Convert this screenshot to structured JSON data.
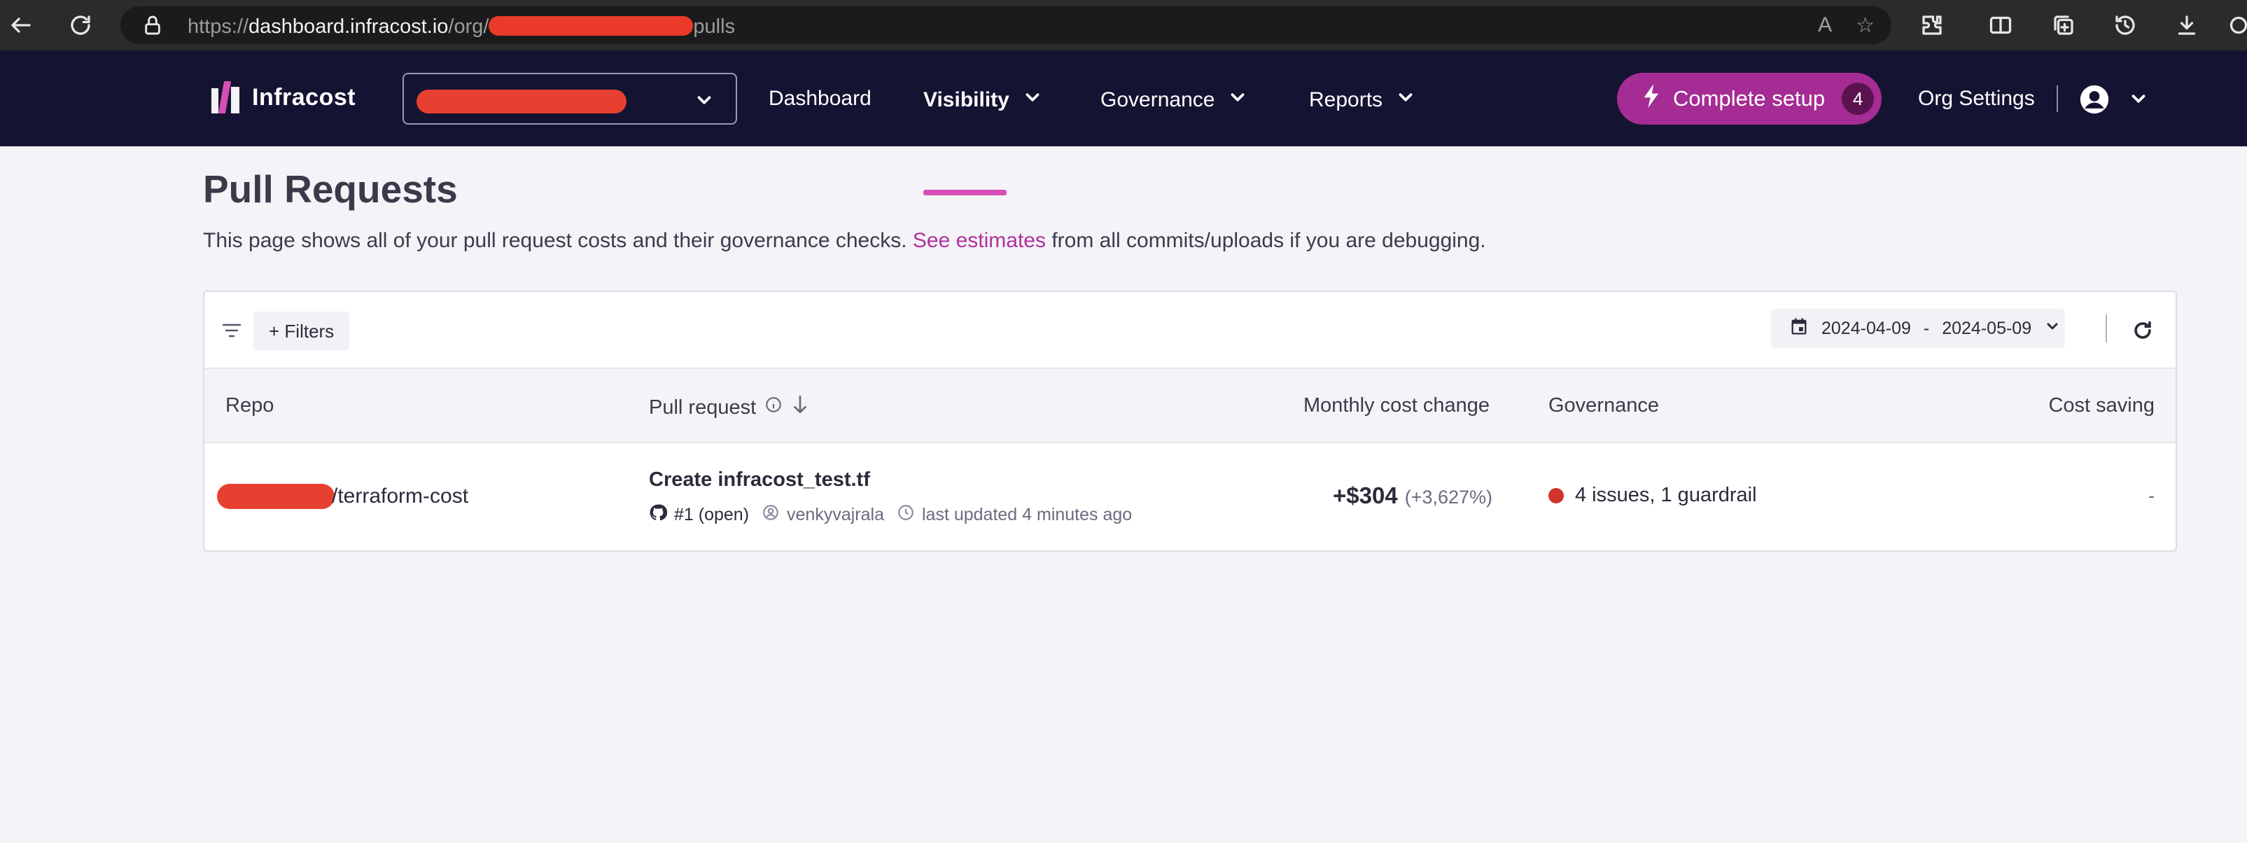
{
  "browser": {
    "url_prefix": "https://",
    "url_host": "dashboard.infracost.io",
    "url_path_before": "/org/",
    "url_path_after": "pulls"
  },
  "nav": {
    "brand": "Infracost",
    "items": [
      {
        "label": "Dashboard"
      },
      {
        "label": "Visibility"
      },
      {
        "label": "Governance"
      },
      {
        "label": "Reports"
      }
    ],
    "setup_label": "Complete setup",
    "setup_count": "4",
    "org_settings": "Org Settings",
    "accent_color": "#d64fb7"
  },
  "page": {
    "title": "Pull Requests",
    "desc_before": "This page shows all of your pull request costs and their governance checks. ",
    "desc_link": "See estimates",
    "desc_after": " from all commits/uploads if you are debugging."
  },
  "toolbar": {
    "filters_label": "+ Filters",
    "date_from": "2024-04-09",
    "date_sep": "-",
    "date_to": "2024-05-09"
  },
  "table": {
    "columns": [
      "Repo",
      "Pull request",
      "Monthly cost change",
      "Governance",
      "Cost saving"
    ],
    "rows": [
      {
        "repo": "/terraform-cost",
        "title": "Create infracost_test.tf",
        "number": "#1 (open)",
        "author": "venkyvajrala",
        "updated": "last updated 4 minutes ago",
        "cost": "+$304",
        "cost_pct": "(+3,627%)",
        "governance": "4 issues, 1 guardrail",
        "governance_color": "#d0342c",
        "saving": "-"
      }
    ]
  }
}
